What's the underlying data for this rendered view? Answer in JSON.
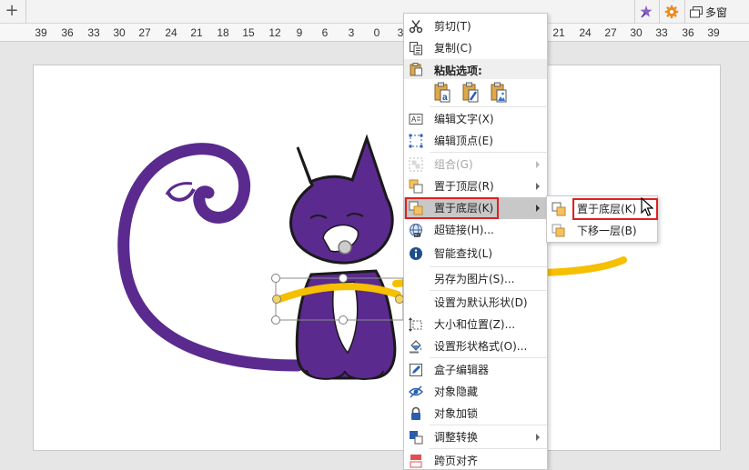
{
  "topbar": {
    "multi_window_label": "多窗"
  },
  "ruler": {
    "ticks": [
      "39",
      "36",
      "33",
      "30",
      "27",
      "24",
      "21",
      "18",
      "15",
      "12",
      "9",
      "6",
      "3",
      "0",
      "3",
      "21",
      "24",
      "27",
      "30",
      "33",
      "36",
      "39"
    ]
  },
  "menu": {
    "cut": "剪切(T)",
    "copy": "复制(C)",
    "paste_options": "粘贴选项:",
    "edit_text": "编辑文字(X)",
    "edit_points": "编辑顶点(E)",
    "group": "组合(G)",
    "bring_to_front": "置于顶层(R)",
    "send_to_back": "置于底层(K)",
    "hyperlink": "超链接(H)...",
    "smart_lookup": "智能查找(L)",
    "save_as_picture": "另存为图片(S)...",
    "set_default_shape": "设置为默认形状(D)",
    "size_and_position": "大小和位置(Z)...",
    "format_shape": "设置形状格式(O)...",
    "box_editor": "盒子编辑器",
    "hide_object": "对象隐藏",
    "lock_object": "对象加锁",
    "adjust_convert": "调整转换",
    "cross_page_align": "跨页对齐"
  },
  "submenu": {
    "send_to_back": "置于底层(K)",
    "send_backward": "下移一层(B)"
  },
  "colors": {
    "cat_purple": "#5b2a8e",
    "shape_yellow": "#f6bf00",
    "highlight_red": "#e02020"
  }
}
